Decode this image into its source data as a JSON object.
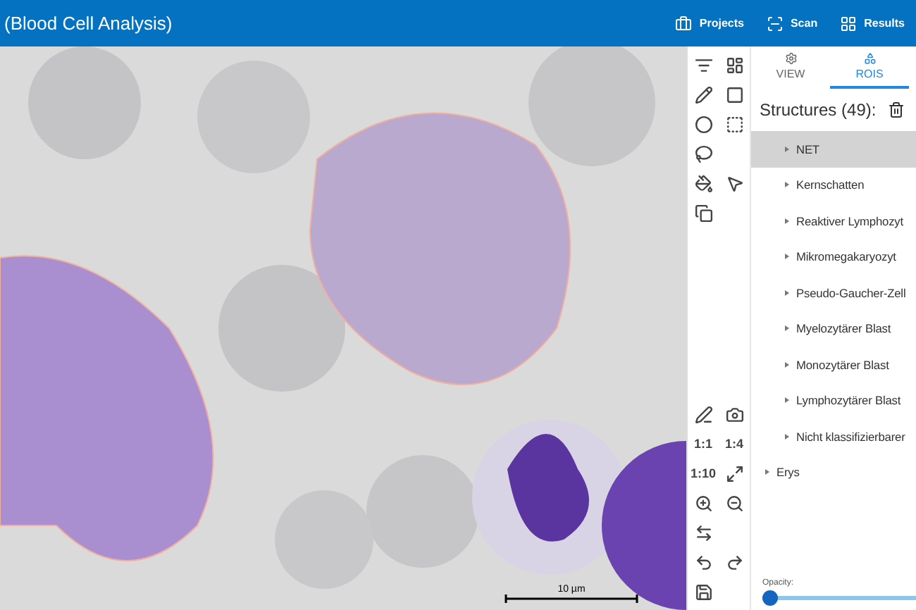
{
  "header": {
    "title": "(Blood Cell Analysis)",
    "nav": [
      {
        "label": "Projects",
        "kind": "projects"
      },
      {
        "label": "Scan",
        "kind": "scan"
      },
      {
        "label": "Results",
        "kind": "results"
      }
    ]
  },
  "viewer": {
    "scale_label": "10 µm"
  },
  "toolbar": {
    "zoom_buttons": [
      "1:1",
      "1:4",
      "1:10"
    ]
  },
  "panel": {
    "tabs": [
      {
        "label": "VIEW",
        "selected": false
      },
      {
        "label": "ROIS",
        "selected": true
      }
    ],
    "structures_label": "Structures (49):",
    "tree": [
      {
        "children": [
          {
            "label": "NET",
            "selected": true,
            "expanded": false
          },
          {
            "label": "Kernschatten",
            "selected": false,
            "expanded": false
          },
          {
            "label": "Reaktiver Lymphozyt",
            "selected": false,
            "expanded": false
          },
          {
            "label": "Mikromegakaryozyt",
            "selected": false,
            "expanded": false
          },
          {
            "label": "Pseudo-Gaucher-Zell",
            "selected": false,
            "expanded": false
          },
          {
            "label": "Myelozytärer Blast",
            "selected": false,
            "expanded": false
          },
          {
            "label": "Monozytärer Blast",
            "selected": false,
            "expanded": false
          },
          {
            "label": "Lymphozytärer Blast",
            "selected": false,
            "expanded": false
          },
          {
            "label": "Nicht klassifizierbarer",
            "selected": false,
            "expanded": false
          }
        ]
      },
      {
        "label": "Erys",
        "selected": false,
        "expanded": false
      }
    ],
    "opacity": {
      "label": "Opacity:",
      "level": 0
    }
  }
}
